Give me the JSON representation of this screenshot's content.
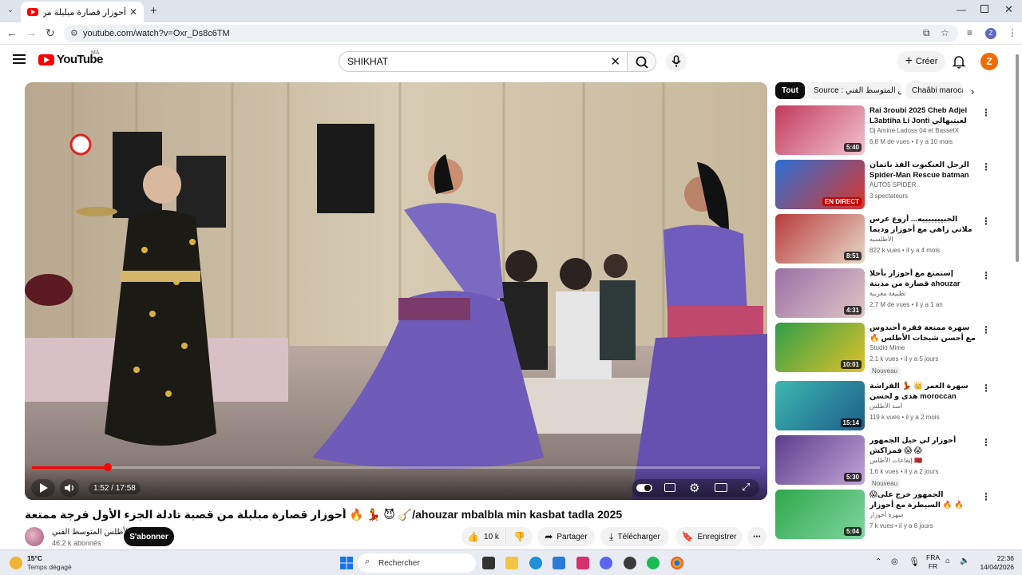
{
  "browser": {
    "tab_title": "أحوزار قصارة مبلبلة من قصبة تادلة الجزء الأول فرجة ممتعة",
    "url": "youtube.com/watch?v=Oxr_Ds8c6TM"
  },
  "header": {
    "logo_text": "YouTube",
    "country_code": "MA",
    "search_value": "SHIKHAT",
    "create_label": "Créer",
    "avatar_letter": "Z"
  },
  "player": {
    "time": "1:52 / 17:58",
    "progress_fraction": 0.104
  },
  "video": {
    "title": "أحوزار قصارة مبلبلة من قصبة تادلة الجزء الأول فرجة ممتعة 🔥 💃 😈 🪕/ahouzar mbalbla min kasbat tadla 2025",
    "channel_name": "الأطلس المتوسط الفني",
    "subscribers": "46,2 k abonnés",
    "subscribe_label": "S'abonner",
    "like_count": "10 k",
    "share_label": "Partager",
    "download_label": "Télécharger",
    "save_label": "Enregistrer"
  },
  "chips": [
    {
      "label": "Tout"
    },
    {
      "label": "Source : الأطلس المتوسط الفني"
    },
    {
      "label": "Chaâbi maroca"
    }
  ],
  "recommendations": [
    {
      "title": "Rai 3roubi 2025 Cheb Adjel L3abtiha Li Jonti لعبتيهالي حونتي ...",
      "channel": "Dj Amine Ladoss 04 et BassetX",
      "meta": "6,8 M de vues • il y a 10 mois",
      "duration": "5:40",
      "badge": "",
      "colors": [
        "#c23a5d",
        "#f3c3d0"
      ]
    },
    {
      "title": "الرجل العنكبوت الفذ باتمان Spider-Man Rescue batman vs iron man vs...",
      "channel": "AUTO5 SPIDER",
      "meta": "3 spectateurs",
      "duration": "EN DIRECT",
      "badge": "",
      "colors": [
        "#2b6fd4",
        "#d9362b"
      ]
    },
    {
      "title": "الجبيييييييه... أروع عرس ملاتي زاهي مع أحوزار وديما النشاط [ الجزء الأول...]",
      "channel": "الأطلسيه",
      "meta": "822 k vues • il y a 4 mois",
      "duration": "8:51",
      "badge": "",
      "colors": [
        "#b83b3b",
        "#e8d9c9"
      ]
    },
    {
      "title": "إستمتع مع أحوزار بأحلا قصارة من مدينة ahouzar ahla/ ميدلت فرجة ممتعة ...",
      "channel": "تطبيقة مغربية",
      "meta": "2,7 M de vues • il y a 1 an",
      "duration": "4:31",
      "badge": "",
      "colors": [
        "#9b6fa6",
        "#e0c6c6"
      ]
    },
    {
      "title": "سهرة ممتعة فقرة أحيدوس مع أحسن شيخات الأطلس 🔥 فرجة ممتعة لعشاق النشاط🪕",
      "channel": "Studio Mime",
      "meta": "2,1 k vues • il y a 5 jours",
      "duration": "10:01",
      "badge": "Nouveau",
      "colors": [
        "#2f9e48",
        "#e0c22b"
      ]
    },
    {
      "title": "سهرة العمر 👑 💃 الفراشة هدى و لحسن moroccan dance deep/ الخنيفري...",
      "channel": "أسد الأطلس",
      "meta": "119 k vues • il y a 2 mois",
      "duration": "15:14",
      "badge": "",
      "colors": [
        "#3bb8b0",
        "#1d5d8a"
      ]
    },
    {
      "title": "أحوزار لي حيل الجمهور فمراكش 😱 😱",
      "channel": "إيقاعات الأطلس 🇲🇦",
      "meta": "1,6 k vues • il y a 2 jours",
      "duration": "5:30",
      "badge": "Nouveau",
      "colors": [
        "#5a3e8c",
        "#c3a3d6"
      ]
    },
    {
      "title": "😱الجمهور خرج على السيطرة مع أحوزار 🔥 🔥",
      "channel": "سهرة أحوزار",
      "meta": "7 k vues • il y a 8 jours",
      "duration": "5:04",
      "badge": "",
      "colors": [
        "#2ea84a",
        "#7fd6a0"
      ]
    }
  ],
  "taskbar": {
    "weather_temp": "15°C",
    "weather_desc": "Temps dégagé",
    "search_label": "Rechercher",
    "lang_top": "FRA",
    "lang_bottom": "FR",
    "time": "22:36",
    "date": "14/04/2026"
  }
}
